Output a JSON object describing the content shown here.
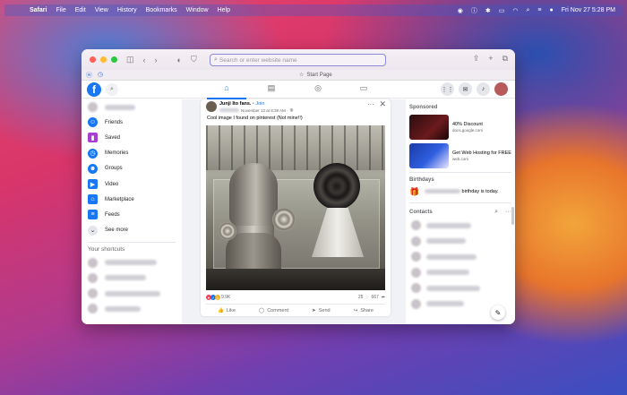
{
  "menubar": {
    "app": "Safari",
    "items": [
      "File",
      "Edit",
      "View",
      "History",
      "Bookmarks",
      "Window",
      "Help"
    ],
    "datetime": "Fri Nov 27  5:28 PM"
  },
  "browser": {
    "address_placeholder": "Search or enter website name",
    "favorites_start": "Start Page"
  },
  "left_nav": {
    "items": [
      {
        "label": "Friends",
        "icon": "friends-icon",
        "color": "#1877f2"
      },
      {
        "label": "Saved",
        "icon": "bookmark-icon",
        "color": "#a93fd1"
      },
      {
        "label": "Memories",
        "icon": "clock-icon",
        "color": "#1877f2"
      },
      {
        "label": "Groups",
        "icon": "groups-icon",
        "color": "#1877f2"
      },
      {
        "label": "Video",
        "icon": "video-icon",
        "color": "#1877f2"
      },
      {
        "label": "Marketplace",
        "icon": "shop-icon",
        "color": "#1877f2"
      },
      {
        "label": "Feeds",
        "icon": "feeds-icon",
        "color": "#1877f2"
      },
      {
        "label": "See more",
        "icon": "chevron-down-icon",
        "color": "#e4e6eb"
      }
    ],
    "shortcuts_title": "Your shortcuts"
  },
  "post": {
    "group": "Junji Ito fans.",
    "join": "Join",
    "meta": "November 12 at 8:38 AM ·",
    "text": "Cool image  I found on pinterest (Not mine!!)",
    "reactions": "9.9K",
    "comments": "25",
    "shares": "667",
    "actions": {
      "like": "Like",
      "comment": "Comment",
      "send": "Send",
      "share": "Share"
    }
  },
  "right": {
    "sponsored_title": "Sponsored",
    "ads": [
      {
        "title": "40% Discount",
        "url": "docs.google.com"
      },
      {
        "title": "Get Web Hosting for FREE",
        "url": "web.com"
      }
    ],
    "birthdays_title": "Birthdays",
    "birthday_text": "birthday is today.",
    "contacts_title": "Contacts"
  }
}
